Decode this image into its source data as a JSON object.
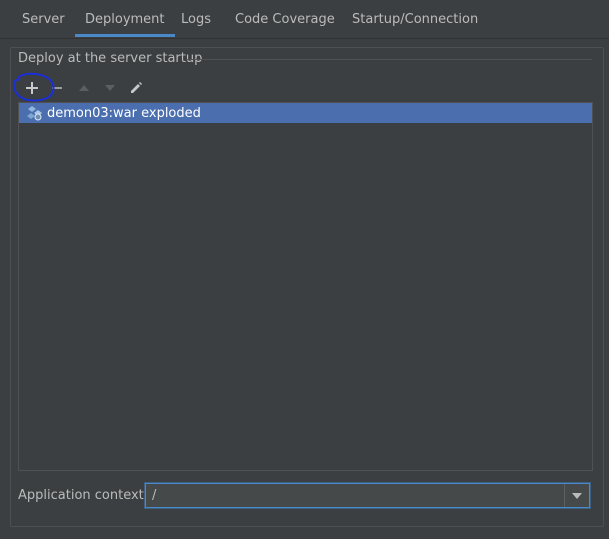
{
  "tabs": [
    {
      "label": "Server"
    },
    {
      "label": "Deployment"
    },
    {
      "label": "Logs"
    },
    {
      "label": "Code Coverage"
    },
    {
      "label": "Startup/Connection"
    }
  ],
  "active_tab": "Deployment",
  "deploy_group": {
    "title": "Deploy at the server startup",
    "toolbar": {
      "add_icon": "plus-icon",
      "remove_icon": "minus-icon",
      "move_up_icon": "arrow-up-icon",
      "move_down_icon": "arrow-down-icon",
      "edit_icon": "pencil-icon"
    },
    "artifacts": [
      {
        "label": "demon03:war exploded",
        "icon": "artifact-war-exploded-icon",
        "selected": true
      }
    ]
  },
  "application_context": {
    "label": "Application context:",
    "value": "/"
  },
  "colors": {
    "background": "#3c3f41",
    "selection": "#4b6eaf",
    "accent": "#4a88c7",
    "annotation": "#1a2fd8"
  }
}
